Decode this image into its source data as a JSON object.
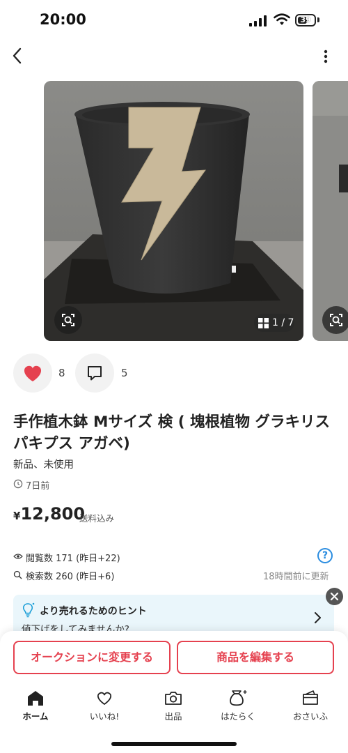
{
  "status_bar": {
    "time": "20:00",
    "battery": "39"
  },
  "gallery": {
    "counter": "1 / 7",
    "current_index": 1,
    "total": 7
  },
  "social": {
    "likes": "8",
    "comments": "5"
  },
  "item": {
    "title": "手作植木鉢 Mサイズ 検 ( 塊根植物 グラキリス パキプス アガベ)",
    "condition": "新品、未使用",
    "posted": "7日前",
    "price_symbol": "¥",
    "price": "12,800",
    "shipping": "送料込み"
  },
  "stats": {
    "views": "閲覧数  171 (昨日+22)",
    "searches": "検索数  260 (昨日+6)",
    "updated": "18時間前に更新",
    "help": "?"
  },
  "hint": {
    "title": "より売れるためのヒント",
    "subtitle": "値下げをしてみませんか?"
  },
  "actions": {
    "auction": "オークションに変更する",
    "edit": "商品を編集する"
  },
  "bottom_nav": [
    {
      "label": "ホーム",
      "icon": "home-icon"
    },
    {
      "label": "いいね!",
      "icon": "heart-outline-icon"
    },
    {
      "label": "出品",
      "icon": "camera-icon"
    },
    {
      "label": "はたらく",
      "icon": "money-bag-icon"
    },
    {
      "label": "おさいふ",
      "icon": "wallet-icon"
    }
  ],
  "colors": {
    "accent": "#e5414f",
    "heart": "#e5414f",
    "info_blue": "#2b8de0",
    "hint_bg": "#eaf6fb"
  }
}
